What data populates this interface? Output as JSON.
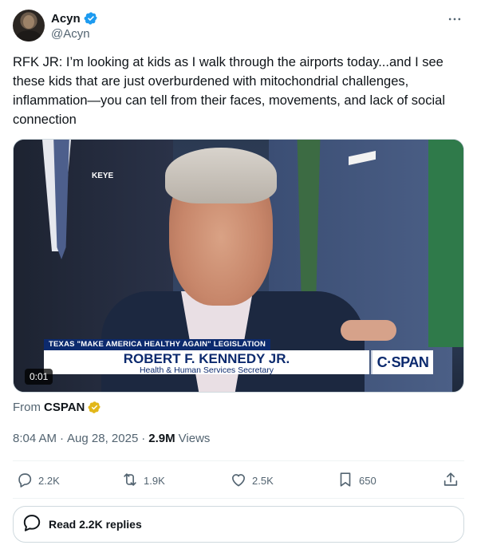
{
  "author": {
    "display_name": "Acyn",
    "handle": "@Acyn",
    "verified": true,
    "verified_color": "#1d9bf0"
  },
  "more_icon": "more-horizontal-icon",
  "tweet": {
    "text": "RFK JR: I’m looking at kids as I walk through the airports today...and I see these kids that are just overburdened with mitochondrial challenges, inflammation—you can tell from their faces, movements, and lack of social connection"
  },
  "video": {
    "station_bug": "KEYE",
    "chyron_top": "TEXAS \"MAKE AMERICA HEALTHY AGAIN\" LEGISLATION",
    "chyron_name": "ROBERT F. KENNEDY JR.",
    "chyron_title": "Health & Human Services Secretary",
    "brand": "C·SPAN",
    "timestamp": "0:01",
    "chyron_color": "#0c2a6e"
  },
  "source": {
    "prefix": "From",
    "name": "CSPAN",
    "badge_color": "#e2b719"
  },
  "meta": {
    "time": "8:04 AM",
    "separator": "·",
    "date": "Aug 28, 2025",
    "views_count": "2.9M",
    "views_label": "Views"
  },
  "actions": {
    "replies": "2.2K",
    "reposts": "1.9K",
    "likes": "2.5K",
    "bookmarks": "650"
  },
  "read_replies": {
    "label": "Read 2.2K replies"
  }
}
